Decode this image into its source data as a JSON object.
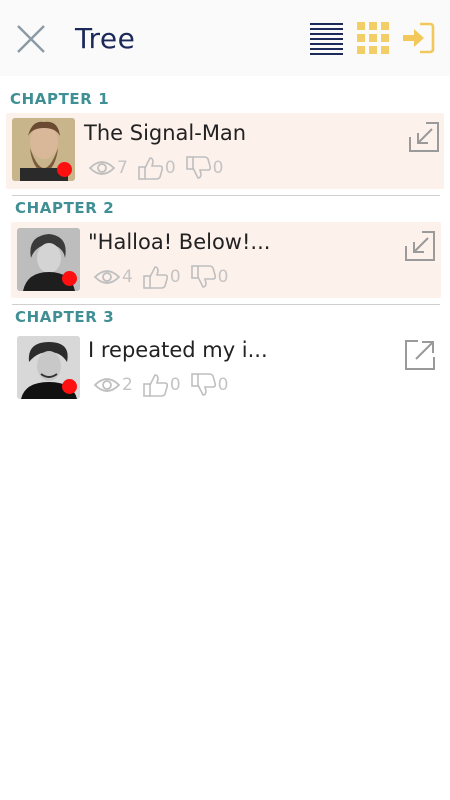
{
  "header": {
    "title": "Tree",
    "icons": {
      "close": "close-icon",
      "list": "list-view-icon",
      "grid": "grid-view-icon",
      "login": "login-icon"
    },
    "colors": {
      "title": "#1c2a5a",
      "grid": "#f2cf66",
      "login": "#f2c85b",
      "list": "#1c2a5a"
    }
  },
  "chapters": [
    {
      "label": "CHAPTER 1",
      "title": "The Signal-Man",
      "views": "7",
      "likes": "0",
      "dislikes": "0",
      "read": true,
      "action_icon": "collapse-arrow-icon"
    },
    {
      "label": "CHAPTER 2",
      "title": "\"Halloa! Below!...",
      "views": "4",
      "likes": "0",
      "dislikes": "0",
      "read": true,
      "action_icon": "collapse-arrow-icon"
    },
    {
      "label": "CHAPTER 3",
      "title": "I repeated my i...",
      "views": "2",
      "likes": "0",
      "dislikes": "0",
      "read": false,
      "action_icon": "external-link-icon"
    }
  ],
  "colors": {
    "chapter_label": "#3f8f94",
    "read_bg": "#fdf1ec",
    "unread_dot": "#ff1010",
    "stat": "#c4c4c4"
  }
}
